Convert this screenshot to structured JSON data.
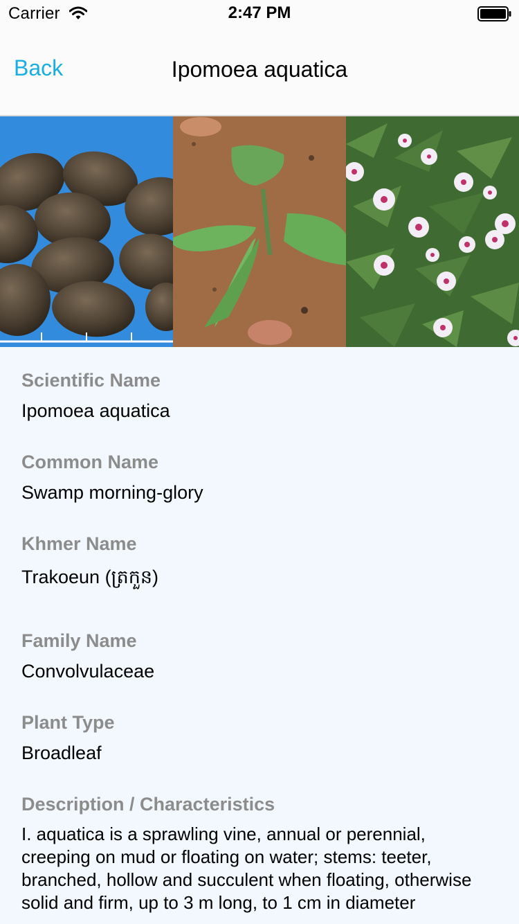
{
  "status_bar": {
    "carrier": "Carrier",
    "time": "2:47 PM"
  },
  "nav": {
    "back_label": "Back",
    "title": "Ipomoea aquatica"
  },
  "images": [
    {
      "name": "seeds-photo"
    },
    {
      "name": "seedling-photo"
    },
    {
      "name": "flowering-plant-photo"
    }
  ],
  "fields": {
    "scientific_name_label": "Scientific Name",
    "scientific_name": "Ipomoea aquatica",
    "common_name_label": "Common Name",
    "common_name": "Swamp morning-glory",
    "khmer_name_label": "Khmer Name",
    "khmer_name": "Trakoeun (ត្រកួន)",
    "family_name_label": "Family Name",
    "family_name": "Convolvulaceae",
    "plant_type_label": "Plant Type",
    "plant_type": "Broadleaf",
    "description_label": "Description / Characteristics",
    "description": "I. aquatica is a sprawling vine, annual or perennial, creeping on mud or floating on water; stems: teeter, branched, hollow and succulent when floating, otherwise solid and firm, up to 3 m long, to 1 cm in diameter"
  },
  "colors": {
    "accent": "#19aee0",
    "label_gray": "#8c8c8c",
    "background": "#f2f8fd"
  }
}
